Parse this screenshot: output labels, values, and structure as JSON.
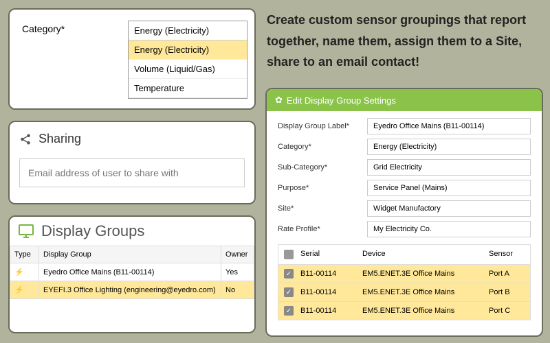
{
  "category": {
    "label": "Category*",
    "selected": "Energy (Electricity)",
    "options": [
      "Energy (Electricity)",
      "Volume (Liquid/Gas)",
      "Temperature"
    ]
  },
  "sharing": {
    "title": "Sharing",
    "placeholder": "Email address of user to share with"
  },
  "display_groups": {
    "title": "Display Groups",
    "cols": {
      "type": "Type",
      "group": "Display Group",
      "owner": "Owner"
    },
    "rows": [
      {
        "group": "Eyedro Office Mains (B11-00114)",
        "owner": "Yes"
      },
      {
        "group": "EYEFI.3 Office Lighting (engineering@eyedro.com)",
        "owner": "No"
      }
    ]
  },
  "promo": "Create custom sensor groupings that report together, name them, assign them to a Site, share to an email contact!",
  "settings": {
    "title": "Edit Display Group Settings",
    "fields": {
      "label_l": "Display Group Label*",
      "label_v": "Eyedro Office Mains (B11-00114)",
      "cat_l": "Category*",
      "cat_v": "Energy (Electricity)",
      "sub_l": "Sub-Category*",
      "sub_v": "Grid Electricity",
      "pur_l": "Purpose*",
      "pur_v": "Service Panel (Mains)",
      "site_l": "Site*",
      "site_v": "Widget Manufactory",
      "rate_l": "Rate Profile*",
      "rate_v": "My Electricity Co."
    },
    "sensor_cols": {
      "serial": "Serial",
      "device": "Device",
      "sensor": "Sensor"
    },
    "sensors": [
      {
        "serial": "B11-00114",
        "device": "EM5.ENET.3E Office Mains",
        "sensor": "Port A"
      },
      {
        "serial": "B11-00114",
        "device": "EM5.ENET.3E Office Mains",
        "sensor": "Port B"
      },
      {
        "serial": "B11-00114",
        "device": "EM5.ENET.3E Office Mains",
        "sensor": "Port C"
      }
    ]
  }
}
